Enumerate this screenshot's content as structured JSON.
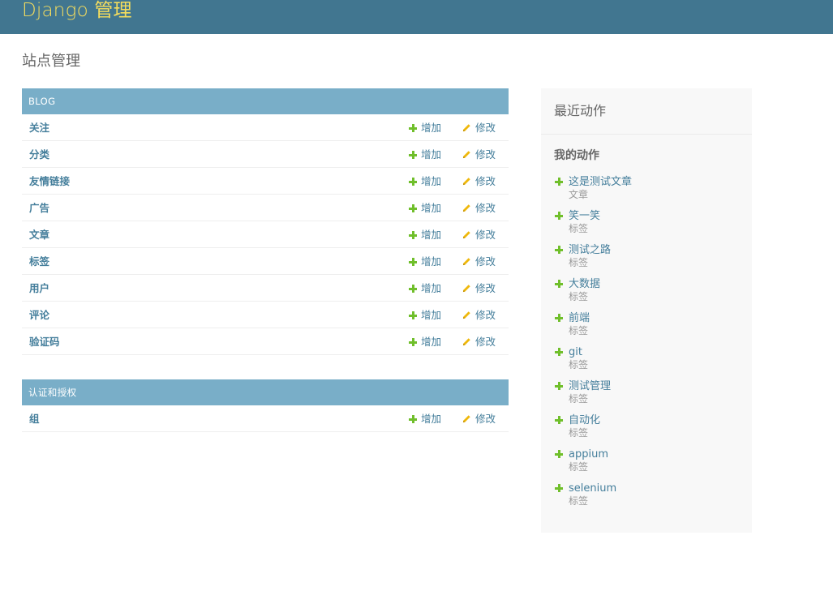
{
  "header": {
    "branding": "Django 管理"
  },
  "page_title": "站点管理",
  "modules": [
    {
      "caption": "BLOG",
      "models": [
        {
          "name": "关注",
          "add_label": "增加",
          "change_label": "修改"
        },
        {
          "name": "分类",
          "add_label": "增加",
          "change_label": "修改"
        },
        {
          "name": "友情链接",
          "add_label": "增加",
          "change_label": "修改"
        },
        {
          "name": "广告",
          "add_label": "增加",
          "change_label": "修改"
        },
        {
          "name": "文章",
          "add_label": "增加",
          "change_label": "修改"
        },
        {
          "name": "标签",
          "add_label": "增加",
          "change_label": "修改"
        },
        {
          "name": "用户",
          "add_label": "增加",
          "change_label": "修改"
        },
        {
          "name": "评论",
          "add_label": "增加",
          "change_label": "修改"
        },
        {
          "name": "验证码",
          "add_label": "增加",
          "change_label": "修改"
        }
      ]
    },
    {
      "caption": "认证和授权",
      "models": [
        {
          "name": "组",
          "add_label": "增加",
          "change_label": "修改"
        }
      ]
    }
  ],
  "recent_actions": {
    "title": "最近动作",
    "my_actions_title": "我的动作",
    "items": [
      {
        "label": "这是测试文章",
        "type": "文章"
      },
      {
        "label": "笑一笑",
        "type": "标签"
      },
      {
        "label": "测试之路",
        "type": "标签"
      },
      {
        "label": "大数据",
        "type": "标签"
      },
      {
        "label": "前端",
        "type": "标签"
      },
      {
        "label": "git",
        "type": "标签"
      },
      {
        "label": "测试管理",
        "type": "标签"
      },
      {
        "label": "自动化",
        "type": "标签"
      },
      {
        "label": "appium",
        "type": "标签"
      },
      {
        "label": "selenium",
        "type": "标签"
      }
    ]
  },
  "colors": {
    "header_bg": "#417690",
    "branding": "#f5dd5d",
    "caption_bg": "#79aec8",
    "link": "#447e9b",
    "add_icon": "#70bf2b",
    "change_icon": "#efb80b"
  },
  "icons": {
    "add": "plus-icon",
    "change": "pencil-icon"
  }
}
